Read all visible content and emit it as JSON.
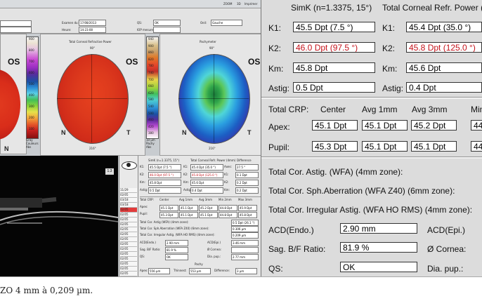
{
  "overview": {
    "menu_items": [
      "ZOOM",
      "3D",
      "Imprimer"
    ],
    "header": {
      "exam_label": "Examen du:",
      "exam_date": "17/08/2013",
      "time_label": "Heure:",
      "time": "14:23:08",
      "qs_label": "QS:",
      "qs_value": "OK",
      "eye_label": "Oeil:",
      "eye_value": "Gauche",
      "iop_label": "IOP mesure:"
    },
    "map1": {
      "eye": "OS",
      "n": "N",
      "t": "T"
    },
    "map2": {
      "title": "Total Corneal Refractive Power",
      "eye": "OS",
      "n": "N",
      "t": "T",
      "angle": "216°",
      "top_angle": "90°"
    },
    "map3": {
      "title": "Pachymeter",
      "eye": "OS",
      "n": "N",
      "t": "T",
      "angle": "216°",
      "top_angle": "90°"
    },
    "legend1": [
      "900",
      "800",
      "700",
      "600",
      "500",
      "400",
      "300",
      "200",
      "100"
    ],
    "legend1_bottom": [
      "Gray",
      "Couleurs",
      "Abs"
    ],
    "legend2": [
      "940",
      "900",
      "860",
      "820",
      "780",
      "740",
      "700",
      "660",
      "620",
      "580",
      "540",
      "500",
      "460",
      "420",
      "380"
    ],
    "legend2_bottom": [
      "10 µm",
      "Pachy",
      "Abs"
    ],
    "scheimpflug_indicator": "1.3",
    "image_list": [
      "11/29",
      "02/05",
      "03/18",
      "03/18",
      "02/05",
      "02/05",
      "02/05",
      "02/05",
      "02/05",
      "02/05",
      "02/05",
      "02/05",
      "02/05",
      "02/05",
      "02/05",
      "02/05",
      "02/05",
      "02/05",
      "02/05",
      "02/05"
    ],
    "mini": {
      "simk": "SimK (n=1.3375, 15°)",
      "tcrp": "Total Corneal Refr. Power (4mm)",
      "diff": "Difference",
      "k1": "45.5 Dpt (7.5 °)",
      "k1b": "45.4 Dpt (35.0 °)",
      "k2": "46.0 Dpt (97.5 °)",
      "k2b": "45.8 Dpt (125.0 °)",
      "km": "45.8 Dpt",
      "kmb": "45.6 Dpt",
      "astig": "0.5 Dpt",
      "astigb": "0.4 Dpt",
      "axes_val": "27.5 °",
      "k1d": "0.1 Dpt",
      "k2d": "0.2 Dpt",
      "kmd": "0.2 Dpt",
      "astigd": "0.1 Dpt",
      "crp_head": [
        "Total CRP:",
        "Center",
        "Avg 1mm",
        "Avg 3mm",
        "Min 2mm",
        "Max 3mm"
      ],
      "apex": [
        "Apex:",
        "45.1 Dpt",
        "45.1 Dpt",
        "45.2 Dpt",
        "44.8 Dpt",
        "45.9 Dpt"
      ],
      "pupil": [
        "Pupil:",
        "45.3 Dpt",
        "45.1 Dpt",
        "45.1 Dpt",
        "44.8 Dpt",
        "45.8 Dpt"
      ],
      "wfa_astig": "Total Cor. Astig (WFA) (4mm zone):",
      "wfa_astig_val": "0.5 Dpt (26.1 °)",
      "sph_ab": "Total Cor. Sph.Aberration (WFA Z40) (6mm zone):",
      "sph_ab_val": "0.306 µm",
      "irr": "Total Cor. Irregular Astig. (WFA HO RMS) (4mm zone):",
      "irr_val": "0.209 µm",
      "acd_label": "ACD(Endo.)",
      "acd_val": "2.90 mm",
      "acd_epi_label": "ACD(Epi.)",
      "acd_epi_val": "3.46 mm",
      "sag_label": "Sag. B/F Ratio:",
      "sag_val": "81.9 %",
      "cornea_label": "Ø Cornea:",
      "qs_label": "QS:",
      "qs_val": "OK",
      "dia_label": "Dia. pup.:",
      "dia_val": "2.77 mm",
      "pachy": "Pachy",
      "apex_label": "Apex:",
      "apex_val": "556 µm",
      "thinnest_label": "Thinnest:",
      "thinnest_val": "553 µm",
      "diff_label": "Difference:",
      "diff_val": "3 µm"
    }
  },
  "detail": {
    "simk_title": "SimK (n=1.3375, 15°)",
    "tcrp_title": "Total Corneal Refr. Power (4mm)",
    "k1_label": "K1:",
    "k1_value": "45.5 Dpt (7.5 °)",
    "k1b_label": "K1:",
    "k1b_value": "45.4 Dpt (35.0 °)",
    "k2_label": "K2:",
    "k2_value": "46.0 Dpt (97.5 °)",
    "k2b_label": "K2:",
    "k2b_value": "45.8 Dpt (125.0 °)",
    "km_label": "Km:",
    "km_value": "45.8 Dpt",
    "kmb_label": "Km:",
    "kmb_value": "45.6 Dpt",
    "astig_label": "Astig:",
    "astig_value": "0.5 Dpt",
    "astigb_label": "Astig:",
    "astigb_value": "0.4 Dpt",
    "crp_title": "Total CRP:",
    "col_center": "Center",
    "col_avg1": "Avg 1mm",
    "col_avg3": "Avg 3mm",
    "col_min": "Min",
    "apex_label": "Apex:",
    "apex_values": [
      "45.1 Dpt",
      "45.1 Dpt",
      "45.2 Dpt",
      "44"
    ],
    "pupil_label": "Pupil:",
    "pupil_values": [
      "45.3 Dpt",
      "45.1 Dpt",
      "45.1 Dpt",
      "44"
    ],
    "wfa_astig": "Total Cor. Astig. (WFA) (4mm zone):",
    "sph_ab": "Total Cor. Sph.Aberration (WFA Z40) (6mm zone):",
    "irr_astig": "Total Cor. Irregular Astig. (WFA HO RMS) (4mm zone):",
    "acd_label": "ACD(Endo.)",
    "acd_value": "2.90 mm",
    "acd_epi_label": "ACD(Epi.)",
    "sag_label": "Sag. B/F Ratio:",
    "sag_value": "81.9 %",
    "cornea_label": "Ø Cornea:",
    "qs_label": "QS:",
    "qs_value": "OK",
    "dia_label": "Dia. pup.:"
  },
  "caption": "ZO 4 mm à 0,209 µm.",
  "colors": {
    "panel": "#dcdcdc",
    "red_value": "#c4121a"
  }
}
